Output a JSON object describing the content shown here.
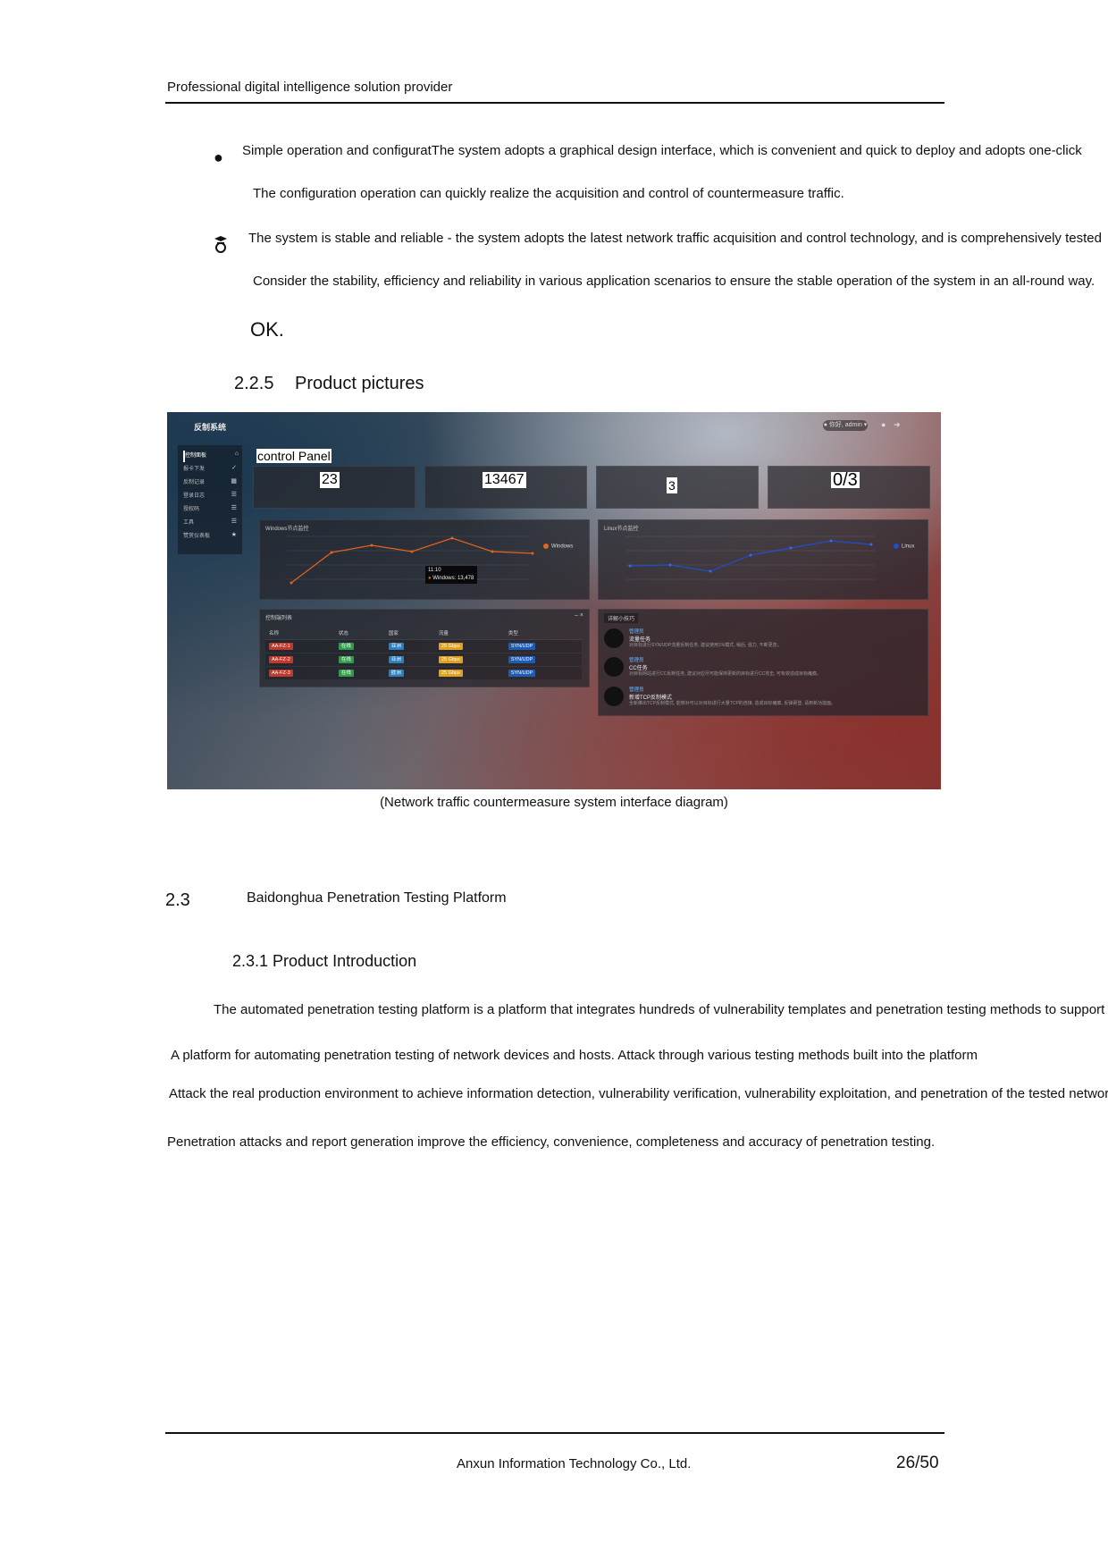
{
  "header": {
    "company_line": "Professional digital intelligence solution provider"
  },
  "bullets": [
    {
      "line1": "Simple operation and configuratThe system adopts a graphical design interface, which is convenient and quick to deploy and adopts one-click",
      "line2": "The configuration operation can quickly realize the acquisition and control of countermeasure traffic."
    },
    {
      "line1": "The system is stable and reliable - the system adopts the latest network traffic acquisition and control technology, and is comprehensively tested",
      "line2": "Consider the stability, efficiency and reliability in various application scenarios to ensure the stable operation of the system in an all-round way.",
      "line3": "OK."
    }
  ],
  "section_225": {
    "number": "2.2.5",
    "title": "Product pictures"
  },
  "screenshot": {
    "logo": "反制系统",
    "user": "● 你好, admin ▾",
    "sidebar": [
      "控制面板",
      "报卡下发",
      "反制记录",
      "登录日志",
      "授权码",
      "工具",
      "赞赏仪表板"
    ],
    "page_title": "control Panel",
    "stats": [
      "23",
      "13467",
      "3",
      "0/3"
    ],
    "windows_chart": {
      "title": "Windows节点监控",
      "legend": "Windows",
      "color": "#e0651e",
      "tooltip_time": "11:10",
      "tooltip_value": "Windows: 13,478"
    },
    "linux_chart": {
      "title": "Linux节点监控",
      "legend": "Linux",
      "color": "#1f4fc8"
    },
    "control_table": {
      "title": "控制端列表",
      "columns": [
        "名称",
        "状态",
        "国家",
        "流量",
        "类型"
      ],
      "rows": [
        [
          "AA-FZ-1",
          "在线",
          "亚洲",
          "25 Gbps",
          "SYN/UDP"
        ],
        [
          "AA-FZ-2",
          "在线",
          "亚洲",
          "25 Gbps",
          "SYN/UDP"
        ],
        [
          "AA-FZ-3",
          "在线",
          "欧洲",
          "25 Gbps",
          "SYN/UDP"
        ]
      ]
    },
    "tips": {
      "title": "详解小技巧",
      "items": [
        {
          "tag": "管理员",
          "title": "流量任务",
          "desc": "对目标进行SYN/UDP流量反制任务, 建议使用1%模式, 稍后, 强力, 不断更迭。"
        },
        {
          "tag": "管理员",
          "title": "CC任务",
          "desc": "对目标网站进行CC反制任务, 建议对应尽可能保持更新的目标进行CC攻击, 可有效造成目标瘫痪。"
        },
        {
          "tag": "管理员",
          "title": "新增TCP反制模式",
          "desc": "全新推出TCP反制模式, 能够对可以对目标进行大量TCP的连接, 造成目标瘫痪, 反弹即登, 请到新功能面。"
        }
      ]
    }
  },
  "figure_caption": "(Network traffic countermeasure system interface diagram)",
  "section_23": {
    "number": "2.3",
    "title": "Baidonghua Penetration Testing Platform"
  },
  "section_231": {
    "title": "2.3.1 Product Introduction"
  },
  "paragraph": [
    "The automated penetration testing platform is a platform that integrates hundreds of vulnerability templates and penetration testing methods to support vario",
    "A platform for automating penetration testing of network devices and hosts. Attack through various testing methods built into the platform",
    "Attack the real production environment to achieve information detection, vulnerability verification, vulnerability exploitation, and penetration of the tested network an",
    "Penetration attacks and report generation improve the efficiency, convenience, completeness and accuracy of penetration testing."
  ],
  "footer": {
    "company": "Anxun Information Technology Co., Ltd.",
    "page": "26/50"
  }
}
